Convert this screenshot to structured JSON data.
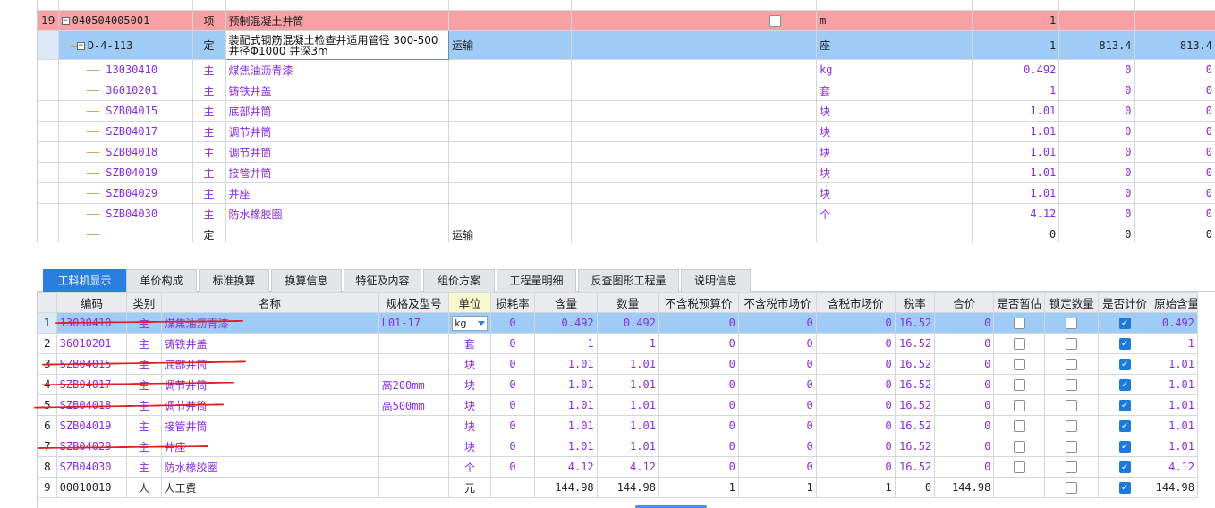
{
  "upper": {
    "item_row": {
      "num": "19",
      "code": "040504005001",
      "type": "项",
      "name": "预制混凝土井筒",
      "unit": "m",
      "qty": "1"
    },
    "quota_row": {
      "code": "D-4-113",
      "type": "定",
      "name": "装配式钢筋混凝土检查井适用管径 300-500 井径Φ1000 井深3m",
      "extra": "运输",
      "unit": "座",
      "qty": "1",
      "price": "813.4",
      "total": "813.4"
    },
    "materials": [
      {
        "code": "13030410",
        "type": "主",
        "name": "煤焦油沥青漆",
        "unit": "kg",
        "qty": "0.492",
        "price": "0",
        "total": "0"
      },
      {
        "code": "36010201",
        "type": "主",
        "name": "铸铁井盖",
        "unit": "套",
        "qty": "1",
        "price": "0",
        "total": "0"
      },
      {
        "code": "SZB04015",
        "type": "主",
        "name": "底部井筒",
        "unit": "块",
        "qty": "1.01",
        "price": "0",
        "total": "0"
      },
      {
        "code": "SZB04017",
        "type": "主",
        "name": "调节井筒",
        "unit": "块",
        "qty": "1.01",
        "price": "0",
        "total": "0"
      },
      {
        "code": "SZB04018",
        "type": "主",
        "name": "调节井筒",
        "unit": "块",
        "qty": "1.01",
        "price": "0",
        "total": "0"
      },
      {
        "code": "SZB04019",
        "type": "主",
        "name": "接管井筒",
        "unit": "块",
        "qty": "1.01",
        "price": "0",
        "total": "0"
      },
      {
        "code": "SZB04029",
        "type": "主",
        "name": "井座",
        "unit": "块",
        "qty": "1.01",
        "price": "0",
        "total": "0"
      },
      {
        "code": "SZB04030",
        "type": "主",
        "name": "防水橡胶圈",
        "unit": "个",
        "qty": "4.12",
        "price": "0",
        "total": "0"
      }
    ],
    "last_row": {
      "type": "定",
      "extra": "运输",
      "qty": "0",
      "price": "0",
      "total": "0"
    }
  },
  "tabs": [
    "工料机显示",
    "单价构成",
    "标准换算",
    "换算信息",
    "特征及内容",
    "组价方案",
    "工程量明细",
    "反查图形工程量",
    "说明信息"
  ],
  "lower": {
    "headers": [
      "编码",
      "类别",
      "名称",
      "规格及型号",
      "单位",
      "损耗率",
      "含量",
      "数量",
      "不含税预算价",
      "不含税市场价",
      "含税市场价",
      "税率",
      "合价",
      "是否暂估",
      "锁定数量",
      "是否计价",
      "原始含量"
    ],
    "rows": [
      {
        "n": "1",
        "code": "13030410",
        "cat": "主",
        "name": "煤焦油沥青漆",
        "spec": "L01-17",
        "unit": "kg",
        "loss": "0",
        "content": "0.492",
        "qty": "0.492",
        "p1": "0",
        "p2": "0",
        "p3": "0",
        "tax": "16.52",
        "sum": "0",
        "orig": "0.492"
      },
      {
        "n": "2",
        "code": "36010201",
        "cat": "主",
        "name": "铸铁井盖",
        "spec": "",
        "unit": "套",
        "loss": "0",
        "content": "1",
        "qty": "1",
        "p1": "0",
        "p2": "0",
        "p3": "0",
        "tax": "16.52",
        "sum": "0",
        "orig": "1"
      },
      {
        "n": "3",
        "code": "SZB04015",
        "cat": "主",
        "name": "底部井筒",
        "spec": "",
        "unit": "块",
        "loss": "0",
        "content": "1.01",
        "qty": "1.01",
        "p1": "0",
        "p2": "0",
        "p3": "0",
        "tax": "16.52",
        "sum": "0",
        "orig": "1.01"
      },
      {
        "n": "4",
        "code": "SZB04017",
        "cat": "主",
        "name": "调节井筒",
        "spec": "高200mm",
        "unit": "块",
        "loss": "0",
        "content": "1.01",
        "qty": "1.01",
        "p1": "0",
        "p2": "0",
        "p3": "0",
        "tax": "16.52",
        "sum": "0",
        "orig": "1.01"
      },
      {
        "n": "5",
        "code": "SZB04018",
        "cat": "主",
        "name": "调节井筒",
        "spec": "高500mm",
        "unit": "块",
        "loss": "0",
        "content": "1.01",
        "qty": "1.01",
        "p1": "0",
        "p2": "0",
        "p3": "0",
        "tax": "16.52",
        "sum": "0",
        "orig": "1.01"
      },
      {
        "n": "6",
        "code": "SZB04019",
        "cat": "主",
        "name": "接管井筒",
        "spec": "",
        "unit": "块",
        "loss": "0",
        "content": "1.01",
        "qty": "1.01",
        "p1": "0",
        "p2": "0",
        "p3": "0",
        "tax": "16.52",
        "sum": "0",
        "orig": "1.01"
      },
      {
        "n": "7",
        "code": "SZB04029",
        "cat": "主",
        "name": "井座",
        "spec": "",
        "unit": "块",
        "loss": "0",
        "content": "1.01",
        "qty": "1.01",
        "p1": "0",
        "p2": "0",
        "p3": "0",
        "tax": "16.52",
        "sum": "0",
        "orig": "1.01"
      },
      {
        "n": "8",
        "code": "SZB04030",
        "cat": "主",
        "name": "防水橡胶圈",
        "spec": "",
        "unit": "个",
        "loss": "0",
        "content": "4.12",
        "qty": "4.12",
        "p1": "0",
        "p2": "0",
        "p3": "0",
        "tax": "16.52",
        "sum": "0",
        "orig": "4.12"
      },
      {
        "n": "9",
        "code": "00010010",
        "cat": "人",
        "name": "人工费",
        "spec": "",
        "unit": "元",
        "loss": "",
        "content": "144.98",
        "qty": "144.98",
        "p1": "1",
        "p2": "1",
        "p3": "1",
        "tax": "0",
        "sum": "144.98",
        "orig": "144.98"
      }
    ]
  },
  "colors": {
    "pink_row": "#f7a1a4",
    "selected_row": "#9fcbf7",
    "active_tab": "#2a7ee0",
    "material_text": "#8a2be2",
    "annotation": "#e02020"
  }
}
